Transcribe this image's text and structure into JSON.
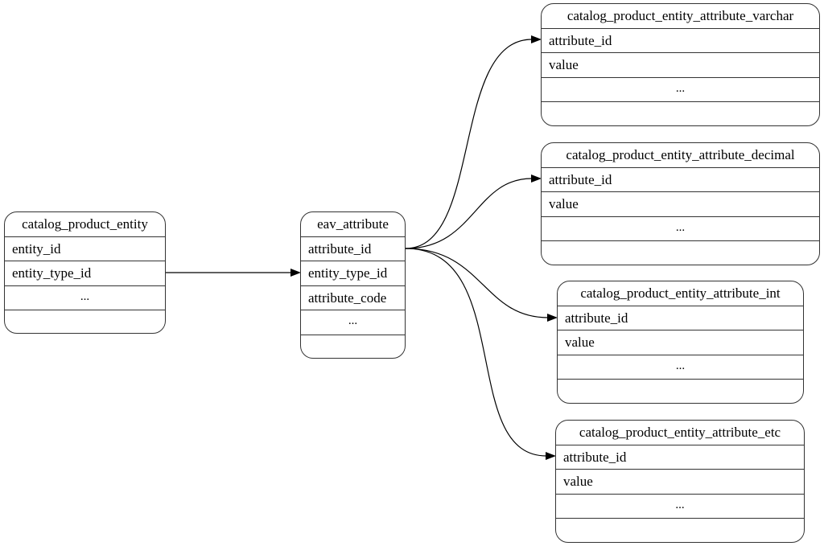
{
  "diagram": {
    "type": "entity-relationship",
    "nodes": [
      {
        "id": "catalog_product_entity",
        "title": "catalog_product_entity",
        "fields": [
          "entity_id",
          "entity_type_id"
        ],
        "ellipsis": "..."
      },
      {
        "id": "eav_attribute",
        "title": "eav_attribute",
        "fields": [
          "attribute_id",
          "entity_type_id",
          "attribute_code"
        ],
        "ellipsis": "..."
      },
      {
        "id": "catalog_product_entity_attribute_varchar",
        "title": "catalog_product_entity_attribute_varchar",
        "fields": [
          "attribute_id",
          "value"
        ],
        "ellipsis": "..."
      },
      {
        "id": "catalog_product_entity_attribute_decimal",
        "title": "catalog_product_entity_attribute_decimal",
        "fields": [
          "attribute_id",
          "value"
        ],
        "ellipsis": "..."
      },
      {
        "id": "catalog_product_entity_attribute_int",
        "title": "catalog_product_entity_attribute_int",
        "fields": [
          "attribute_id",
          "value"
        ],
        "ellipsis": "..."
      },
      {
        "id": "catalog_product_entity_attribute_etc",
        "title": "catalog_product_entity_attribute_etc",
        "fields": [
          "attribute_id",
          "value"
        ],
        "ellipsis": "..."
      }
    ],
    "edges": [
      {
        "from": "catalog_product_entity.entity_type_id",
        "to": "eav_attribute.entity_type_id"
      },
      {
        "from": "eav_attribute.attribute_id",
        "to": "catalog_product_entity_attribute_varchar.attribute_id"
      },
      {
        "from": "eav_attribute.attribute_id",
        "to": "catalog_product_entity_attribute_decimal.attribute_id"
      },
      {
        "from": "eav_attribute.attribute_id",
        "to": "catalog_product_entity_attribute_int.attribute_id"
      },
      {
        "from": "eav_attribute.attribute_id",
        "to": "catalog_product_entity_attribute_etc.attribute_id"
      }
    ]
  }
}
